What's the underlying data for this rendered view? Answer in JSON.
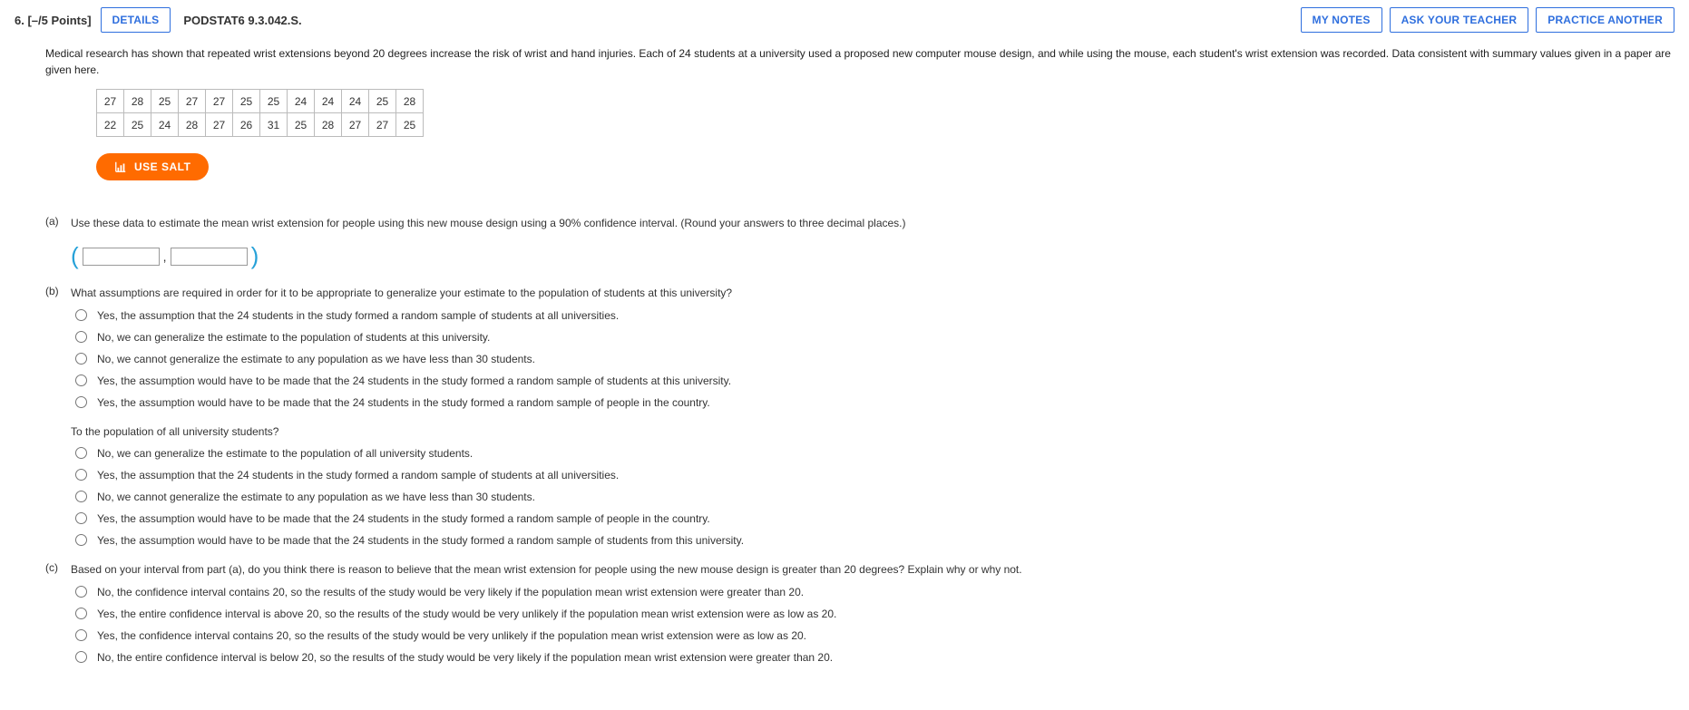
{
  "header": {
    "number_points": "6.  [–/5 Points]",
    "details": "DETAILS",
    "source": "PODSTAT6 9.3.042.S.",
    "my_notes": "MY NOTES",
    "ask_teacher": "ASK YOUR TEACHER",
    "practice_another": "PRACTICE ANOTHER"
  },
  "intro": "Medical research has shown that repeated wrist extensions beyond 20 degrees increase the risk of wrist and hand injuries. Each of 24 students at a university used a proposed new computer mouse design, and while using the mouse, each student's wrist extension was recorded. Data consistent with summary values given in a paper are given here.",
  "data_rows": [
    [
      "27",
      "28",
      "25",
      "27",
      "27",
      "25",
      "25",
      "24",
      "24",
      "24",
      "25",
      "28"
    ],
    [
      "22",
      "25",
      "24",
      "28",
      "27",
      "26",
      "31",
      "25",
      "28",
      "27",
      "27",
      "25"
    ]
  ],
  "salt_label": "USE SALT",
  "part_a": {
    "label": "(a)",
    "text": "Use these data to estimate the mean wrist extension for people using this new mouse design using a 90% confidence interval. (Round your answers to three decimal places.)"
  },
  "part_b": {
    "label": "(b)",
    "text": "What assumptions are required in order for it to be appropriate to generalize your estimate to the population of students at this university?",
    "options1": [
      "Yes, the assumption that the 24 students in the study formed a random sample of students at all universities.",
      "No, we can generalize the estimate to the population of students at this university.",
      "No, we cannot generalize the estimate to any population as we have less than 30 students.",
      "Yes, the assumption would have to be made that the 24 students in the study formed a random sample of students at this university.",
      "Yes, the assumption would have to be made that the 24 students in the study formed a random sample of people in the country."
    ],
    "sub2": "To the population of all university students?",
    "options2": [
      "No, we can generalize the estimate to the population of all university students.",
      "Yes, the assumption that the 24 students in the study formed a random sample of students at all universities.",
      "No, we cannot generalize the estimate to any population as we have less than 30 students.",
      "Yes, the assumption would have to be made that the 24 students in the study formed a random sample of people in the country.",
      "Yes, the assumption would have to be made that the 24 students in the study formed a random sample of students from this university."
    ]
  },
  "part_c": {
    "label": "(c)",
    "text": "Based on your interval from part (a), do you think there is reason to believe that the mean wrist extension for people using the new mouse design is greater than 20 degrees? Explain why or why not.",
    "options": [
      "No, the confidence interval contains 20, so the results of the study would be very likely if the population mean wrist extension were greater than 20.",
      "Yes, the entire confidence interval is above 20, so the results of the study would be very unlikely if the population mean wrist extension were as low as 20.",
      "Yes, the confidence interval contains 20, so the results of the study would be very unlikely if the population mean wrist extension were as low as 20.",
      "No, the entire confidence interval is below 20, so the results of the study would be very likely if the population mean wrist extension were greater than 20."
    ]
  }
}
